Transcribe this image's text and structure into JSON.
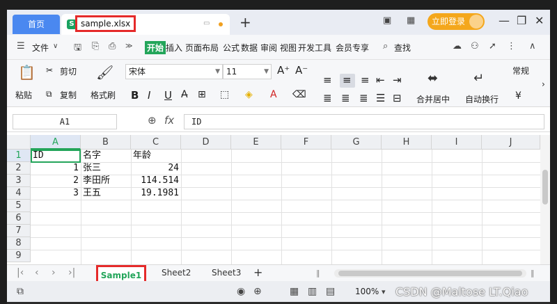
{
  "titlebar": {
    "home_tab": "首页",
    "file_tab": "sample.xlsx",
    "file_icon": "S",
    "new_tab_label": "+",
    "login_label": "立即登录"
  },
  "menubar": {
    "file_menu": "文件",
    "tabs": [
      "开始",
      "插入",
      "页面布局",
      "公式",
      "数据",
      "审阅",
      "视图",
      "开发工具",
      "会员专享"
    ],
    "search_label": "查找"
  },
  "ribbon": {
    "paste": "粘贴",
    "cut": "剪切",
    "copy": "复制",
    "format_painter": "格式刷",
    "font_name": "宋体",
    "font_size": "11",
    "merge_center": "合并居中",
    "wrap_text": "自动换行",
    "number_format": "常规",
    "currency_symbol": "¥"
  },
  "formula_bar": {
    "name_box": "A1",
    "fx_label": "fx",
    "value": "ID"
  },
  "sheet": {
    "columns": [
      "A",
      "B",
      "C",
      "D",
      "E",
      "F",
      "G",
      "H",
      "I",
      "J"
    ],
    "rows": [
      "1",
      "2",
      "3",
      "4",
      "5",
      "6",
      "7",
      "8",
      "9"
    ],
    "header_row": [
      "ID",
      "名字",
      "年龄"
    ],
    "data": [
      {
        "id": "1",
        "name": "张三",
        "age": "24"
      },
      {
        "id": "2",
        "name": "李田所",
        "age": "114.514"
      },
      {
        "id": "3",
        "name": "王五",
        "age": "19.1981"
      }
    ],
    "selected_cell": "A1"
  },
  "sheet_tabs": {
    "tabs": [
      "Sample1",
      "Sheet2",
      "Sheet3"
    ],
    "active": "Sample1",
    "add_label": "+"
  },
  "statusbar": {
    "zoom": "100%",
    "watermark": "CSDN @Maltose LT.Qiao"
  },
  "colors": {
    "accent_green": "#23a55a",
    "highlight_red": "#e52a2a",
    "home_blue": "#4a88f0",
    "login_orange": "#f4a71c"
  }
}
